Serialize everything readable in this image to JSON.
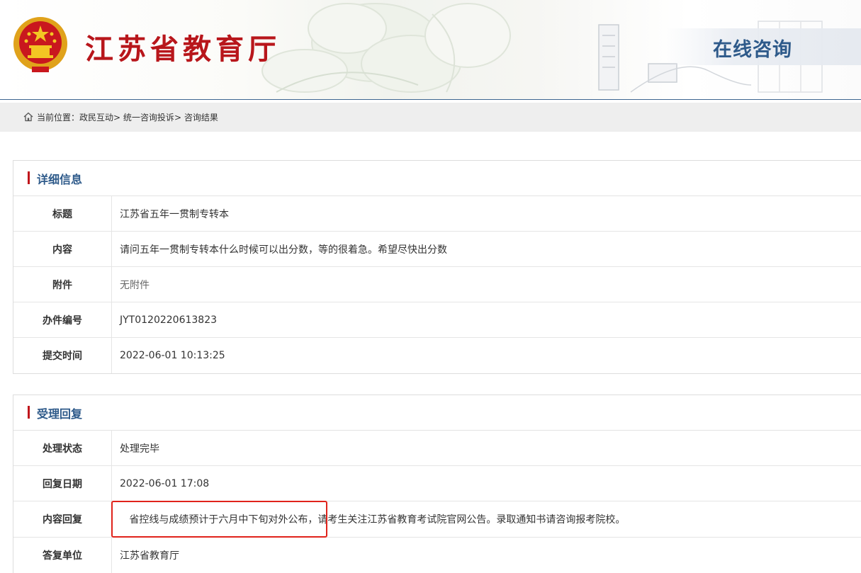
{
  "header": {
    "site_title": "江苏省教育厅",
    "section_tag": "在线咨询",
    "colors": {
      "title_red": "#b8161b",
      "brand_blue": "#3d6590",
      "label_blue": "#2e5a8a"
    }
  },
  "breadcrumb": {
    "prefix": "当前位置：",
    "items": [
      "政民互动",
      "统一咨询投诉",
      "咨询结果"
    ],
    "separator": ">"
  },
  "detail_panel": {
    "title": "详细信息",
    "rows": [
      {
        "label": "标题",
        "value": "江苏省五年一贯制专转本"
      },
      {
        "label": "内容",
        "value": "请问五年一贯制专转本什么时候可以出分数，等的很着急。希望尽快出分数"
      },
      {
        "label": "附件",
        "value": "无附件"
      },
      {
        "label": "办件编号",
        "value": "JYT0120220613823"
      },
      {
        "label": "提交时间",
        "value": "2022-06-01 10:13:25"
      }
    ]
  },
  "reply_panel": {
    "title": "受理回复",
    "rows": [
      {
        "label": "处理状态",
        "value": "处理完毕"
      },
      {
        "label": "回复日期",
        "value": "2022-06-01 17:08"
      },
      {
        "label": "内容回复",
        "value": "   省控线与成绩预计于六月中下旬对外公布，请考生关注江苏省教育考试院官网公告。录取通知书请咨询报考院校。"
      },
      {
        "label": "答复单位",
        "value": "江苏省教育厅"
      }
    ]
  }
}
